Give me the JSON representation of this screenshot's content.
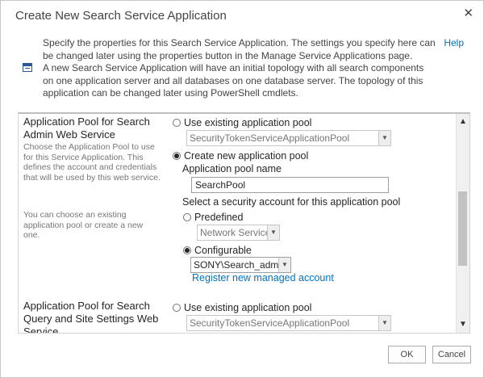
{
  "dialog": {
    "title": "Create New Search Service Application",
    "close_glyph": "✕",
    "help_label": "Help",
    "intro_para1": "Specify the properties for this Search Service Application. The settings you specify here can be changed later using the properties button in the Manage Service Applications page.",
    "intro_para2": "A new Search Service Application will have an initial topology with all search components on one application server and all databases on one database server. The topology of this application can be changed later using PowerShell cmdlets."
  },
  "section1": {
    "title": "Application Pool for Search Admin Web Service",
    "desc1": "Choose the Application Pool to use for this Service Application. This defines the account and credentials that will be used by this web service.",
    "desc2": "You can choose an existing application pool or create a new one.",
    "use_existing_label": "Use existing application pool",
    "existing_pool_value": "SecurityTokenServiceApplicationPool",
    "create_new_label": "Create new application pool",
    "pool_name_label": "Application pool name",
    "pool_name_value": "SearchPool",
    "security_label": "Select a security account for this application pool",
    "predefined_label": "Predefined",
    "predefined_value": "Network Service",
    "configurable_label": "Configurable",
    "configurable_value": "SONY\\Search_admin",
    "register_link": "Register new managed account"
  },
  "section2": {
    "title": "Application Pool for Search Query and Site Settings Web Service",
    "use_existing_label": "Use existing application pool",
    "existing_pool_value": "SecurityTokenServiceApplicationPool"
  },
  "buttons": {
    "ok": "OK",
    "cancel": "Cancel"
  },
  "icons": {
    "info": "service-application-icon",
    "dropdown": "chevron-down-icon",
    "scroll_up": "scroll-up-icon",
    "scroll_down": "scroll-down-icon"
  },
  "colors": {
    "link": "#0072c6",
    "text": "#444444",
    "muted": "#777777"
  }
}
